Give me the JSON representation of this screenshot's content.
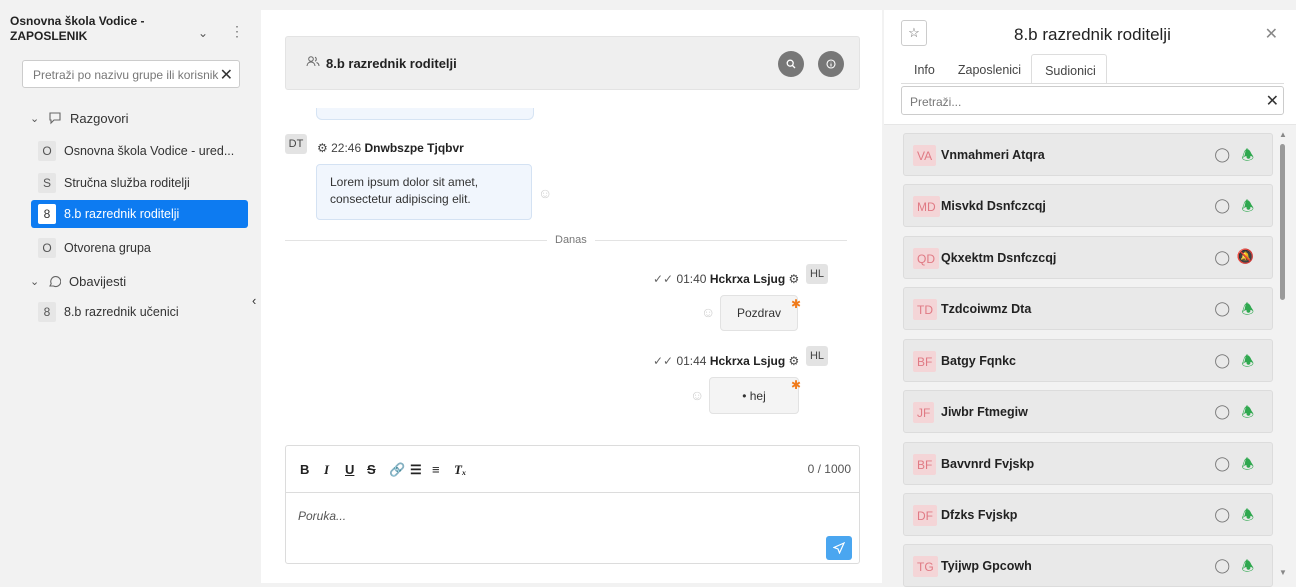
{
  "sidebar": {
    "org_name": "Osnovna škola Vodice - ZAPOSLENIK",
    "search_placeholder": "Pretraži po nazivu grupe ili korisnik",
    "sections": [
      {
        "label": "Razgovori",
        "icon": "chat-search-icon"
      },
      {
        "label": "Obavijesti",
        "icon": "chat-icon"
      }
    ],
    "conversations": [
      {
        "badge": "O",
        "label": "Osnovna škola Vodice - ured..."
      },
      {
        "badge": "S",
        "label": "Stručna služba roditelji"
      },
      {
        "badge": "8",
        "label": "8.b razrednik roditelji",
        "active": true
      },
      {
        "badge": "O",
        "label": "Otvorena grupa"
      }
    ],
    "notices": [
      {
        "badge": "8",
        "label": "8.b razrednik učenici"
      }
    ]
  },
  "chat": {
    "title": "8.b razrednik roditelji",
    "messages": [
      {
        "initials": "DT",
        "time": "22:46",
        "author": "Dnwbszpe Tjqbvr",
        "text": "Lorem ipsum dolor sit amet, consectetur adipiscing elit."
      },
      {
        "initials": "HL",
        "time": "01:40",
        "author": "Hckrxa Lsjug",
        "text": "Pozdrav"
      },
      {
        "initials": "HL",
        "time": "01:44",
        "author": "Hckrxa Lsjug",
        "text": "• hej"
      }
    ],
    "divider_label": "Danas",
    "composer": {
      "counter": "0 / 1000",
      "placeholder": "Poruka..."
    },
    "accent_color": "#0d7bf1"
  },
  "panel": {
    "title": "8.b razrednik roditelji",
    "tabs": [
      "Info",
      "Zaposlenici",
      "Sudionici"
    ],
    "active_tab": "Sudionici",
    "search_placeholder": "Pretraži...",
    "participants": [
      {
        "initials": "VA",
        "name": "Vnmahmeri Atqra",
        "notifications": "on"
      },
      {
        "initials": "MD",
        "name": "Misvkd Dsnfczcqj",
        "notifications": "on"
      },
      {
        "initials": "QD",
        "name": "Qkxektm Dsnfczcqj",
        "notifications": "off"
      },
      {
        "initials": "TD",
        "name": "Tzdcoiwmz Dta",
        "notifications": "on"
      },
      {
        "initials": "BF",
        "name": "Batgy Fqnkc",
        "notifications": "on"
      },
      {
        "initials": "JF",
        "name": "Jiwbr Ftmegiw",
        "notifications": "on"
      },
      {
        "initials": "BF",
        "name": "Bavvnrd Fvjskp",
        "notifications": "on"
      },
      {
        "initials": "DF",
        "name": "Dfzks Fvjskp",
        "notifications": "on"
      },
      {
        "initials": "TG",
        "name": "Tyijwp Gpcowh",
        "notifications": "on"
      }
    ]
  }
}
